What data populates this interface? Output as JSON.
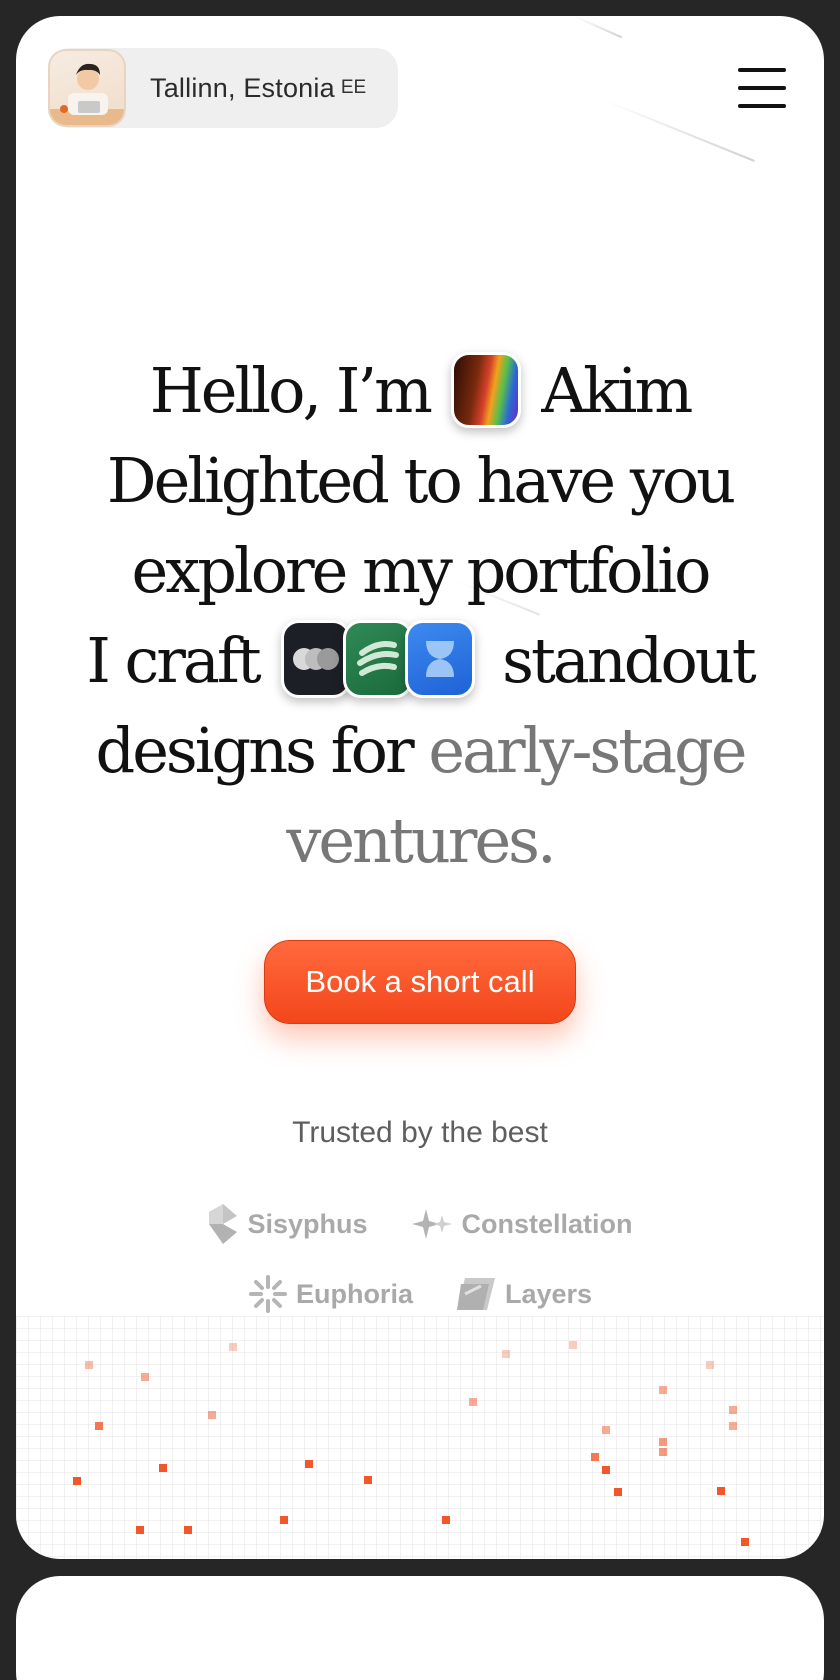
{
  "header": {
    "location": "Tallinn, Estonia",
    "country_code": "EE",
    "menu_icon": "hamburger-menu-icon"
  },
  "hero": {
    "line1_a": "Hello, I’m",
    "line1_b": "Akim",
    "line2": "Delighted to have you",
    "line3": "explore my portfolio",
    "line4_a": "I craft",
    "line4_b": "standout",
    "line5_a": "designs for",
    "line5_b": "early-stage",
    "line6": "ventures."
  },
  "cta": {
    "label": "Book a short call",
    "color": "#f3461b"
  },
  "trusted": {
    "title": "Trusted by the best",
    "logos": [
      "Sisyphus",
      "Constellation",
      "Euphoria",
      "Layers"
    ]
  },
  "colors": {
    "accent": "#f0572a",
    "frame": "#262626",
    "muted_text": "#777777"
  }
}
